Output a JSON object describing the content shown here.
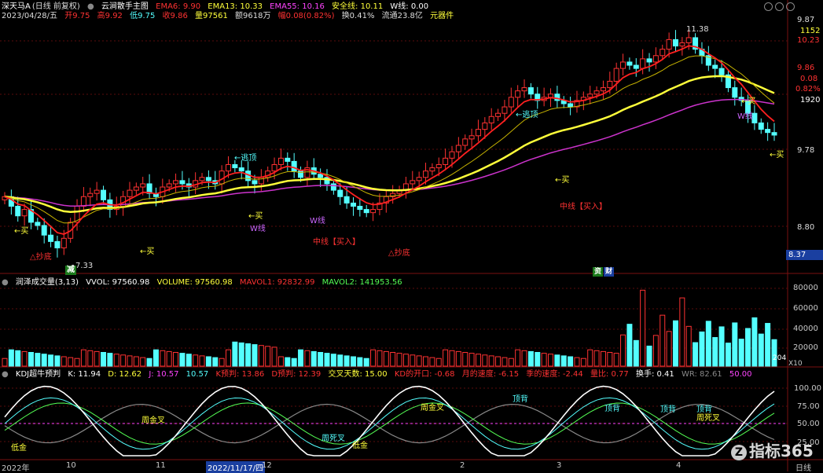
{
  "header": {
    "stock_name": "深天马A",
    "mode": "(日线 前复权)",
    "indicator_title": "云涧散手主图",
    "ema6": "EMA6: 9.90",
    "ema13": "EMA13: 10.33",
    "ema55": "EMA55: 10.16",
    "safe_line": "安全线: 10.11",
    "w_line": "W线: 0.00",
    "date": "2023/04/28/五",
    "open": "开9.75",
    "high": "高9.92",
    "low": "低9.75",
    "close": "收9.86",
    "volume": "量97561",
    "amount": "额9618万",
    "change": "幅0.08(0.82%)",
    "turnover": "换0.41%",
    "float_cap": "流通23.8亿",
    "sector": "元器件"
  },
  "price_axis": {
    "labels": [
      "9.87",
      "1152",
      "10.23",
      "9.86",
      "0.08",
      "0.82%",
      "1920",
      "9.78",
      "8.80"
    ],
    "current_price_box": "8.37",
    "grid_labels": [
      "9.78",
      "8.80"
    ]
  },
  "price_annotations": {
    "peak": "11.38",
    "low_label": "7.33",
    "escape_top_1": "←逃顶",
    "escape_top_2": "←逃顶",
    "buy_1": "←买",
    "buy_2": "←买",
    "buy_3": "←买",
    "buy_4": "←买",
    "buy_5": "←买",
    "buy_6": "←买",
    "reduce": "减",
    "w_line_1": "W线",
    "w_line_2": "W线",
    "w_line_3": "W线",
    "bottom_1": "△抄底",
    "bottom_2": "△抄底",
    "mid_buy_1": "中线【买入】",
    "mid_buy_2": "中线【买入】",
    "news_tag": "资",
    "finance_tag": "财"
  },
  "volume_panel": {
    "title": "润泽成交量(3,13)",
    "vvol": "VVOL: 97560.98",
    "volume": "VOLUME: 97560.98",
    "mavol1": "MAVOL1: 92832.99",
    "mavol2": "MAVOL2: 141953.56",
    "axis_labels": [
      "80000",
      "60000",
      "40000",
      "20000"
    ],
    "unit": "X10",
    "last_label": "204"
  },
  "kdj_panel": {
    "title": "KDJ超牛预判",
    "k": "K: 11.94",
    "d": "D: 12.62",
    "j": "J: 10.57",
    "extra": "10.57",
    "k_pred": "K预判: 13.86",
    "d_pred": "D预判: 12.39",
    "cross_days": "交叉天数: 15.00",
    "kd_open": "KD的开口: -0.68",
    "month_speed": "月的速度: -6.15",
    "season_speed": "季的速度: -2.44",
    "vol_ratio": "量比: 0.77",
    "turnover": "换手: 0.41",
    "wr": "WR: 82.61",
    "fifty": "50.00",
    "axis_labels": [
      "100.00",
      "75.00",
      "50.00",
      "25.00"
    ],
    "annotations": {
      "golden_1": "低金",
      "golden_2": "周金叉",
      "golden_3": "周金叉",
      "death_1": "周死叉",
      "death_2": "周死叉",
      "low_golden": "低金",
      "top_1": "顶背",
      "top_2": "顶背",
      "top_3": "顶背",
      "top_4": "顶背"
    }
  },
  "time_axis": {
    "labels": [
      "2022年",
      "10",
      "11",
      "2022/11/17/四",
      "12",
      "2",
      "3",
      "4"
    ],
    "period": "日线"
  },
  "watermark": "指标365",
  "chart_data": {
    "type": "candlestick",
    "title": "",
    "closes": [
      8.9,
      8.75,
      8.6,
      8.7,
      8.5,
      8.45,
      8.3,
      8.2,
      8.1,
      8.25,
      8.5,
      8.75,
      8.9,
      8.95,
      9.0,
      8.85,
      8.7,
      8.75,
      8.9,
      9.0,
      9.05,
      9.1,
      8.95,
      8.9,
      9.05,
      9.1,
      9.15,
      9.1,
      9.05,
      9.15,
      9.2,
      9.15,
      9.1,
      9.3,
      9.4,
      9.35,
      9.3,
      9.15,
      9.1,
      9.2,
      9.3,
      9.4,
      9.5,
      9.45,
      9.3,
      9.2,
      9.35,
      9.25,
      9.2,
      9.1,
      9.0,
      8.9,
      8.8,
      8.75,
      8.7,
      8.65,
      8.7,
      8.8,
      8.9,
      8.95,
      9.0,
      9.1,
      9.15,
      9.2,
      9.3,
      9.35,
      9.4,
      9.5,
      9.6,
      9.7,
      9.8,
      9.85,
      9.95,
      10.05,
      10.15,
      10.2,
      10.3,
      10.45,
      10.55,
      10.6,
      10.5,
      10.4,
      10.45,
      10.5,
      10.4,
      10.35,
      10.3,
      10.4,
      10.45,
      10.5,
      10.55,
      10.6,
      10.7,
      10.9,
      11.0,
      10.95,
      10.9,
      11.05,
      11.0,
      11.1,
      11.2,
      11.35,
      11.25,
      11.3,
      11.38,
      11.2,
      11.1,
      10.95,
      10.9,
      10.8,
      10.6,
      10.45,
      10.4,
      10.2,
      10.05,
      9.95,
      9.9,
      9.86
    ],
    "mavol1_name": "MAVOL1",
    "mavol2_name": "MAVOL2"
  },
  "colors": {
    "up": "#ff3232",
    "down": "#54ffff",
    "ema_yellow": "#ffff3a",
    "ema_purple": "#cc33cc",
    "ema_red": "#ff2020",
    "ema_thin_yellow": "#c8b400",
    "grid": "#7a1010"
  }
}
